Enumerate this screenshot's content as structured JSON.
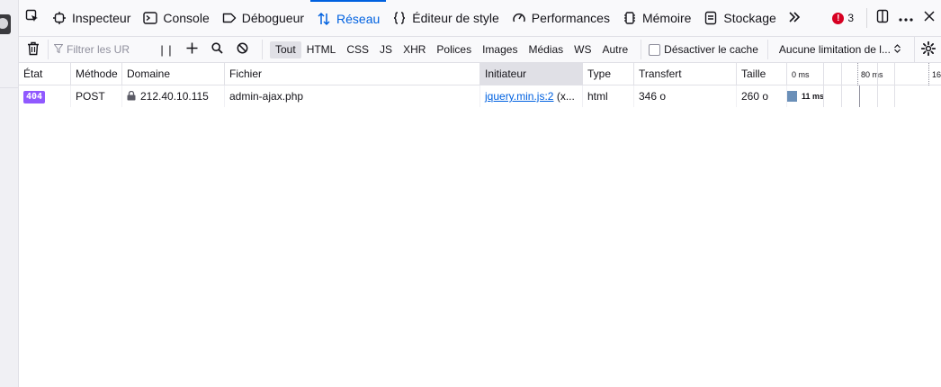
{
  "tabs": [
    {
      "label": "Inspecteur",
      "icon": "inspector-icon"
    },
    {
      "label": "Console",
      "icon": "console-icon"
    },
    {
      "label": "Débogueur",
      "icon": "debugger-icon"
    },
    {
      "label": "Réseau",
      "icon": "network-icon",
      "selected": true
    },
    {
      "label": "Éditeur de style",
      "icon": "style-editor-icon"
    },
    {
      "label": "Performances",
      "icon": "performance-icon"
    },
    {
      "label": "Mémoire",
      "icon": "memory-icon"
    },
    {
      "label": "Stockage",
      "icon": "storage-icon"
    }
  ],
  "error_count": "3",
  "toolbar": {
    "filter_placeholder": "Filtrer les UR",
    "pause_label": "| |",
    "type_filters": [
      {
        "label": "Tout",
        "active": true
      },
      {
        "label": "HTML"
      },
      {
        "label": "CSS"
      },
      {
        "label": "JS"
      },
      {
        "label": "XHR"
      },
      {
        "label": "Polices"
      },
      {
        "label": "Images"
      },
      {
        "label": "Médias"
      },
      {
        "label": "WS"
      },
      {
        "label": "Autre"
      }
    ],
    "disable_cache_label": "Désactiver le cache",
    "throttling_label": "Aucune limitation de l..."
  },
  "table": {
    "columns": [
      "État",
      "Méthode",
      "Domaine",
      "Fichier",
      "Initiateur",
      "Type",
      "Transfert",
      "Taille"
    ],
    "sorted_column": "Initiateur",
    "waterfall_ticks": [
      "0 ms",
      "80 ms",
      "16"
    ],
    "rows": [
      {
        "status": "404",
        "method": "POST",
        "domain": "212.40.10.115",
        "file": "admin-ajax.php",
        "initiator_link": "jquery.min.js:2",
        "initiator_rest": "(x...",
        "type": "html",
        "transferred": "346 o",
        "size": "260 o",
        "timing": "11 ms"
      }
    ]
  },
  "colors": {
    "accent": "#0061e0",
    "status_badge": "#9059ff",
    "error": "#d70022",
    "timing_bar": "#6a8fb8"
  }
}
